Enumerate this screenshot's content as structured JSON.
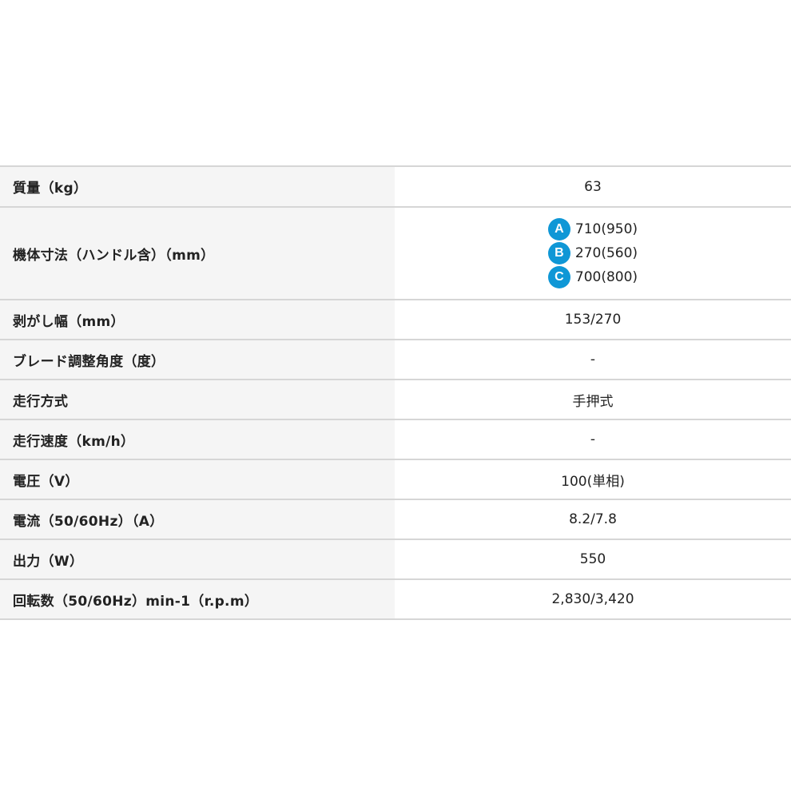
{
  "rows": [
    {
      "label": "質量（kg）",
      "value": "63"
    },
    {
      "label": "機体寸法（ハンドル含）（mm）",
      "dims": [
        {
          "badge": "A",
          "value": "710(950)"
        },
        {
          "badge": "B",
          "value": "270(560)"
        },
        {
          "badge": "C",
          "value": "700(800)"
        }
      ]
    },
    {
      "label": "剥がし幅（mm）",
      "value": "153/270"
    },
    {
      "label": "ブレード調整角度（度）",
      "value": "-"
    },
    {
      "label": "走行方式",
      "value": "手押式"
    },
    {
      "label": "走行速度（km/h）",
      "value": "-"
    },
    {
      "label": "電圧（V）",
      "value": "100(単相)"
    },
    {
      "label": "電流（50/60Hz）（A）",
      "value": "8.2/7.8"
    },
    {
      "label": "出力（W）",
      "value": "550"
    },
    {
      "label": "回転数（50/60Hz）min-1（r.p.m）",
      "value": "2,830/3,420"
    }
  ],
  "colors": {
    "badge": "#0f97d6",
    "label_bg": "#f5f5f5",
    "border": "#d6d6d6"
  }
}
